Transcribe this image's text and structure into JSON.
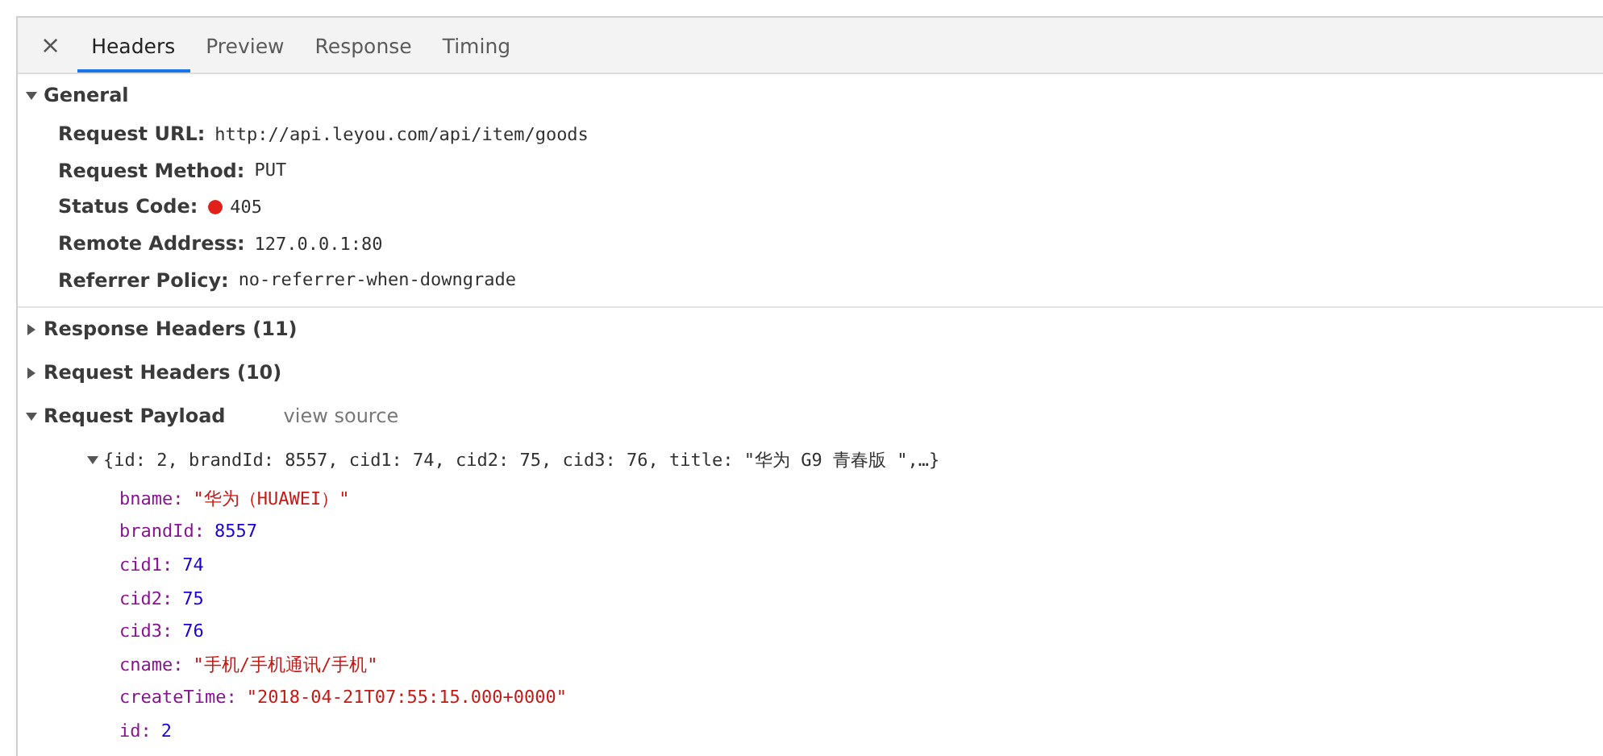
{
  "close": "×",
  "tabs": [
    {
      "label": "Headers",
      "selected": true
    },
    {
      "label": "Preview",
      "selected": false
    },
    {
      "label": "Response",
      "selected": false
    },
    {
      "label": "Timing",
      "selected": false
    }
  ],
  "general": {
    "title": "General",
    "expanded": true,
    "fields": [
      {
        "label": "Request URL:",
        "value": "http://api.leyou.com/api/item/goods"
      },
      {
        "label": "Request Method:",
        "value": "PUT"
      },
      {
        "label": "Status Code:",
        "value": "405",
        "color": "#e0201b"
      },
      {
        "label": "Remote Address:",
        "value": "127.0.0.1:80"
      },
      {
        "label": "Referrer Policy:",
        "value": "no-referrer-when-downgrade"
      }
    ]
  },
  "sections": [
    {
      "title": "Response Headers (11)",
      "expanded": false
    },
    {
      "title": "Request Headers (10)",
      "expanded": false
    }
  ],
  "payload": {
    "title": "Request Payload",
    "expanded": true,
    "link": "view source",
    "summary": {
      "text": "{id: 2, brandId: 8557, cid1: 74, cid2: 75, cid3: 76, title: \"华为 G9 青春版 \",…}",
      "expanded": true
    },
    "properties": [
      {
        "key": "bname:",
        "value": "\"华为（HUAWEI）\"",
        "kind": "string"
      },
      {
        "key": "brandId:",
        "value": "8557",
        "kind": "number"
      },
      {
        "key": "cid1:",
        "value": "74",
        "kind": "number"
      },
      {
        "key": "cid2:",
        "value": "75",
        "kind": "number"
      },
      {
        "key": "cid3:",
        "value": "76",
        "kind": "number"
      },
      {
        "key": "cname:",
        "value": "\"手机/手机通讯/手机\"",
        "kind": "string"
      },
      {
        "key": "createTime:",
        "value": "\"2018-04-21T07:55:15.000+0000\"",
        "kind": "string"
      },
      {
        "key": "id:",
        "value": "2",
        "kind": "number"
      }
    ]
  }
}
